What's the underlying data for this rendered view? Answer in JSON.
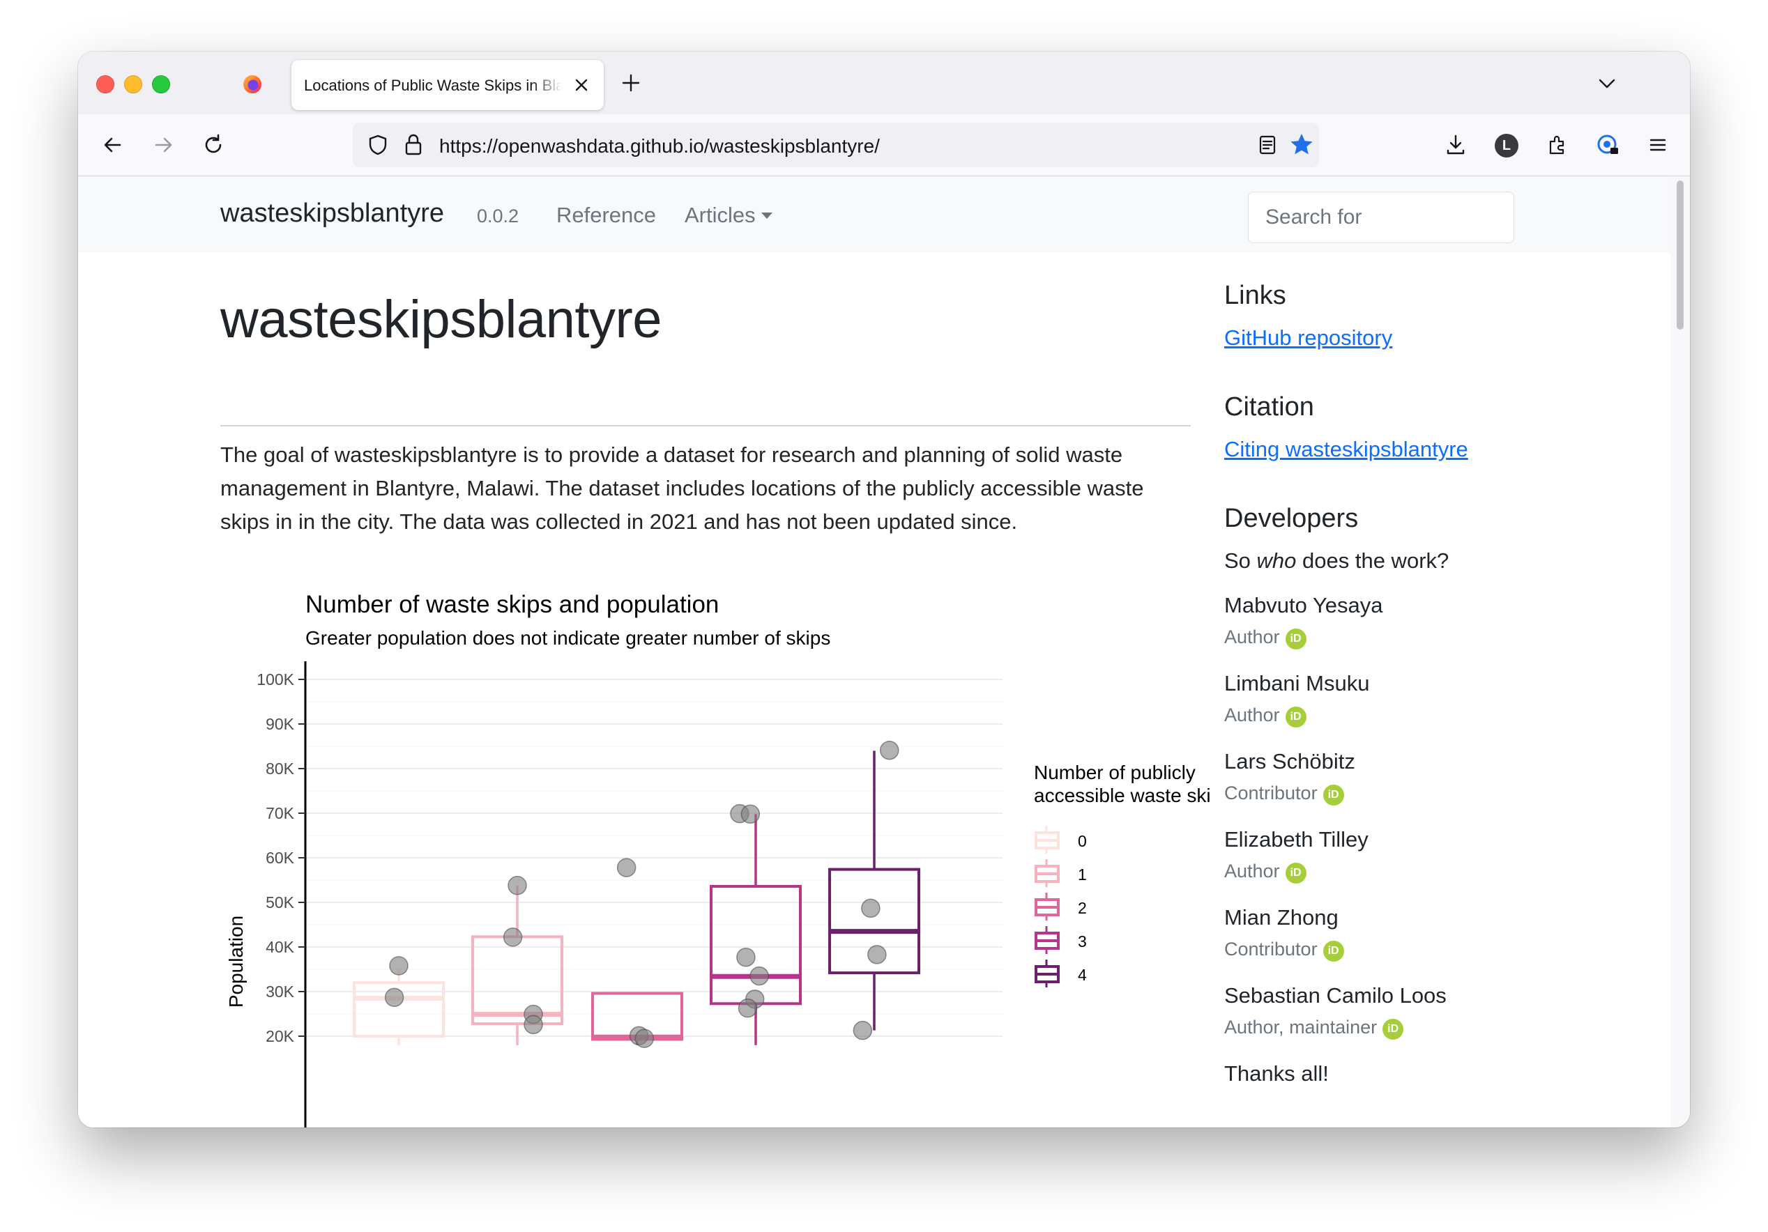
{
  "browser": {
    "tab_title": "Locations of Public Waste Skips in Blantyre",
    "url": "https://openwashdata.github.io/wasteskipsblantyre/",
    "profile_initial": "L",
    "accent_color": "#1f6feb"
  },
  "site_nav": {
    "brand": "wasteskipsblantyre",
    "version": "0.0.2",
    "reference": "Reference",
    "articles": "Articles",
    "search_placeholder": "Search for"
  },
  "main": {
    "title": "wasteskipsblantyre",
    "intro": "The goal of wasteskipsblantyre is to provide a dataset for research and planning of solid waste management in Blantyre, Malawi. The dataset includes locations of the publicly accessible waste skips in in the city. The data was collected in 2021 and has not been updated since."
  },
  "chart_data": {
    "type": "boxplot",
    "title": "Number of waste skips and population",
    "subtitle": "Greater population does not indicate greater number of skips",
    "ylabel": "Population",
    "y_ticks": [
      "20K",
      "30K",
      "40K",
      "50K",
      "60K",
      "70K",
      "80K",
      "90K",
      "100K"
    ],
    "y_tick_values": [
      20000,
      30000,
      40000,
      50000,
      60000,
      70000,
      80000,
      90000,
      100000
    ],
    "ylim": [
      18500,
      104000
    ],
    "legend_title_line1": "Number of publicly",
    "legend_title_line2": "accessible waste skips",
    "legend_placement": "right",
    "grid": true,
    "groups": [
      {
        "name": "0",
        "color": "#fde3dd",
        "box": {
          "q1": 20000,
          "median": 28500,
          "q3": 32000,
          "whisker_low": 18000,
          "whisker_high": 35000
        },
        "points": [
          {
            "j": -0.0,
            "y": 35800
          },
          {
            "j": -0.05,
            "y": 28700
          }
        ]
      },
      {
        "name": "1",
        "color": "#f4b3bf",
        "box": {
          "q1": 22800,
          "median": 24900,
          "q3": 42300,
          "whisker_low": 18000,
          "whisker_high": 53800
        },
        "points": [
          {
            "j": 0.0,
            "y": 53800
          },
          {
            "j": -0.05,
            "y": 42200
          },
          {
            "j": 0.18,
            "y": 24900
          },
          {
            "j": 0.18,
            "y": 22600
          }
        ]
      },
      {
        "name": "2",
        "color": "#e0659a",
        "box": {
          "q1": 19300,
          "median": 19800,
          "q3": 29600,
          "whisker_low": 18000,
          "whisker_high": 29600
        },
        "points": [
          {
            "j": -0.12,
            "y": 57800
          },
          {
            "j": 0.02,
            "y": 20100
          },
          {
            "j": 0.08,
            "y": 19500
          }
        ]
      },
      {
        "name": "3",
        "color": "#b5358a",
        "box": {
          "q1": 27300,
          "median": 33400,
          "q3": 53600,
          "whisker_low": 18000,
          "whisker_high": 69800
        },
        "points": [
          {
            "j": -0.18,
            "y": 69900
          },
          {
            "j": -0.06,
            "y": 69800
          },
          {
            "j": -0.11,
            "y": 37700
          },
          {
            "j": 0.04,
            "y": 33500
          },
          {
            "j": -0.01,
            "y": 28300
          },
          {
            "j": -0.09,
            "y": 26300
          }
        ]
      },
      {
        "name": "4",
        "color": "#6b1f6c",
        "box": {
          "q1": 34200,
          "median": 43500,
          "q3": 57400,
          "whisker_low": 21300,
          "whisker_high": 84000
        },
        "points": [
          {
            "j": 0.17,
            "y": 84100
          },
          {
            "j": -0.04,
            "y": 48700
          },
          {
            "j": 0.03,
            "y": 38300
          },
          {
            "j": -0.13,
            "y": 21300
          }
        ]
      }
    ]
  },
  "sidebar": {
    "links_heading": "Links",
    "github_link": "GitHub repository",
    "citation_heading": "Citation",
    "citation_link": "Citing wasteskipsblantyre",
    "developers_heading": "Developers",
    "developers_intro_pre": "So ",
    "developers_intro_em": "who",
    "developers_intro_post": " does the work?",
    "orcid_badge": "iD",
    "developers": [
      {
        "name": "Mabvuto Yesaya",
        "role": "Author"
      },
      {
        "name": "Limbani Msuku",
        "role": "Author"
      },
      {
        "name": "Lars Schöbitz",
        "role": "Contributor"
      },
      {
        "name": "Elizabeth Tilley",
        "role": "Author"
      },
      {
        "name": "Mian Zhong",
        "role": "Contributor"
      },
      {
        "name": "Sebastian Camilo Loos",
        "role": "Author, maintainer"
      }
    ],
    "thanks": "Thanks all!"
  }
}
